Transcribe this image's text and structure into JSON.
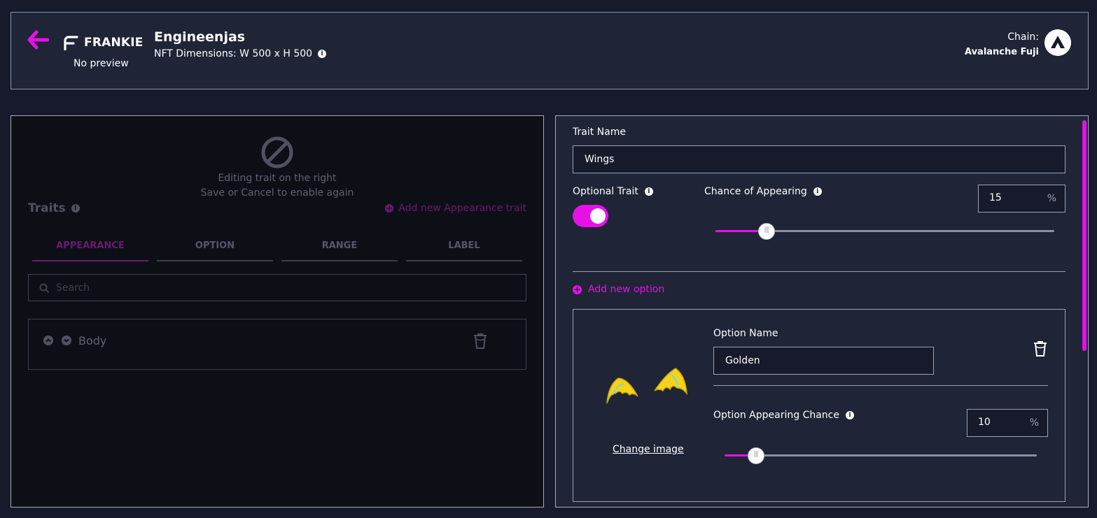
{
  "header": {
    "back_icon": "arrow-left-icon",
    "logo_text": "FRANKIE",
    "no_preview": "No preview",
    "project_title": "Engineenjas",
    "dimensions": "NFT Dimensions: W 500 x H 500",
    "chain_label": "Chain:",
    "chain_value": "Avalanche Fuji",
    "accent_color": "#e611e6"
  },
  "left_panel": {
    "overlay_line1": "Editing trait on the right",
    "overlay_line2": "Save or Cancel to enable again",
    "traits_title": "Traits",
    "add_trait": "Add new Appearance trait",
    "tabs": [
      {
        "label": "APPEARANCE",
        "active": true
      },
      {
        "label": "OPTION"
      },
      {
        "label": "RANGE"
      },
      {
        "label": "LABEL"
      }
    ],
    "search_placeholder": "Search",
    "trait_rows": [
      {
        "label": "Body"
      }
    ]
  },
  "right_panel": {
    "trait_name_label": "Trait Name",
    "trait_name_value": "Wings",
    "optional_trait_label": "Optional Trait",
    "optional_trait_on": true,
    "chance_label": "Chance of Appearing",
    "chance_value": "15",
    "chance_percent": 15,
    "percent_sign": "%",
    "add_option": "Add new option",
    "option": {
      "name_label": "Option Name",
      "name_value": "Golden",
      "change_image": "Change image",
      "chance_label": "Option Appearing Chance",
      "chance_value": "10",
      "chance_percent": 10,
      "percent_sign": "%"
    }
  }
}
